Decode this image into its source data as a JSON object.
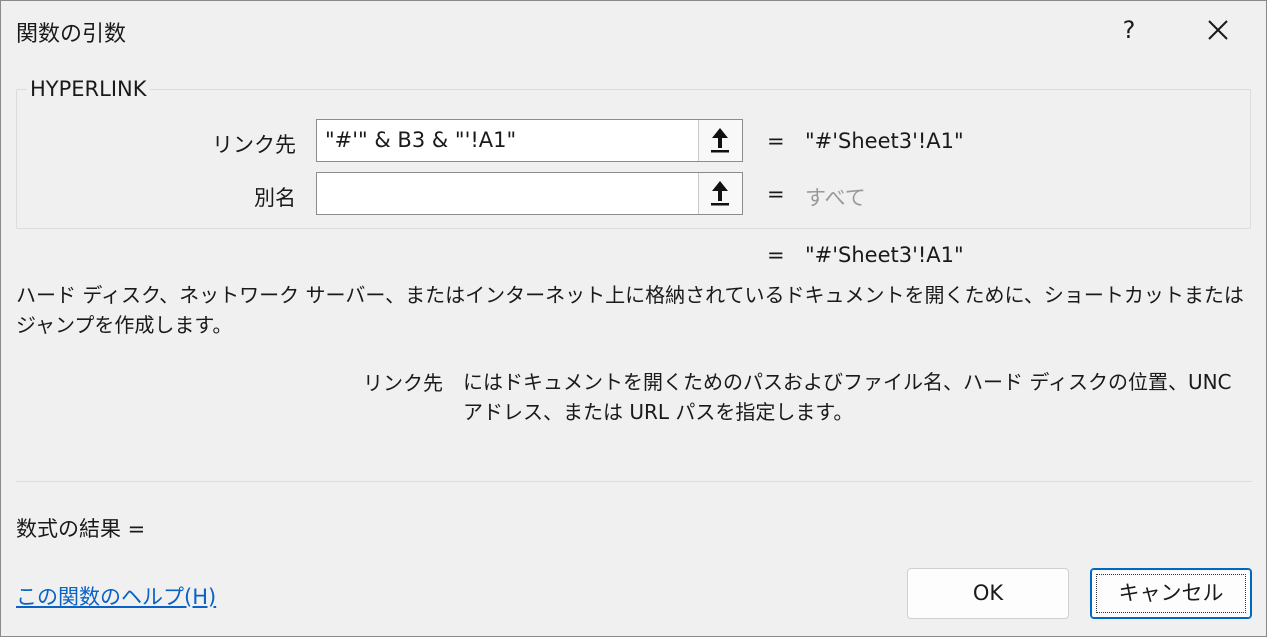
{
  "window": {
    "title": "関数の引数",
    "help_glyph": "?",
    "close_icon": "close-icon"
  },
  "function_group": {
    "name": "HYPERLINK",
    "arguments": [
      {
        "label": "リンク先",
        "value": "\"#'\" & B3 & \"'!A1\"",
        "equals": "=",
        "result": "\"#'Sheet3'!A1\"",
        "ref_icon": "collapse-dialog-arrow-icon"
      },
      {
        "label": "別名",
        "value": "",
        "equals": "=",
        "result": "すべて",
        "ref_icon": "collapse-dialog-arrow-icon"
      }
    ]
  },
  "function_result": {
    "equals": "=",
    "value": "\"#'Sheet3'!A1\""
  },
  "description": "ハード ディスク、ネットワーク サーバー、またはインターネット上に格納されているドキュメントを開くために、ショートカットまたはジャンプを作成します。",
  "argument_help": {
    "name": "リンク先",
    "text": "にはドキュメントを開くためのパスおよびファイル名、ハード ディスクの位置、UNC アドレス、または URL パスを指定します。"
  },
  "formula_result_label": "数式の結果 =",
  "help_link": "この関数のヘルプ(H)",
  "buttons": {
    "ok": "OK",
    "cancel": "キャンセル"
  },
  "colors": {
    "background": "#f0f0f0",
    "link": "#0a62c4",
    "focus_border": "#0067c0",
    "muted_text": "#9a9a9a"
  }
}
